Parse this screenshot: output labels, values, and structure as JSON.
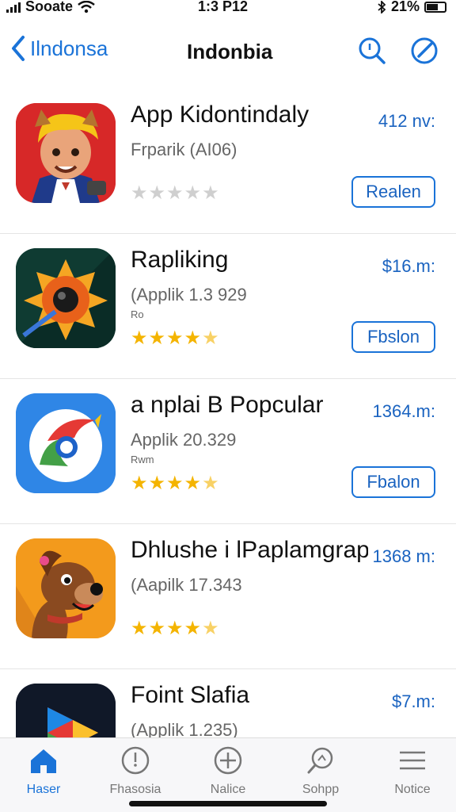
{
  "status": {
    "carrier": "Sooate",
    "time": "1:3 P12",
    "battery": "21%"
  },
  "nav": {
    "back_label": "Ilndonsa",
    "title": "Indonbia"
  },
  "apps": [
    {
      "name": "App Kidontindaly",
      "subtitle": "Frparik (AI06)",
      "extra": "",
      "price": "412 nv:",
      "button": "Realen",
      "rating": 0,
      "icon": "kid-character-icon"
    },
    {
      "name": "Rapliking",
      "subtitle": "(Applik 1.3 929",
      "extra": "Ro",
      "price": "$16.m:",
      "button": "Fbslon",
      "rating": 4.5,
      "icon": "sun-camera-icon"
    },
    {
      "name": "a nplai B Popcular",
      "subtitle": "Applik 20.329",
      "extra": "Rwm",
      "price": "1364.m:",
      "button": "Fbalon",
      "rating": 4.5,
      "icon": "chrome-swirl-icon"
    },
    {
      "name": "Dhlushe i lPaplamgrapm",
      "subtitle": "(Aapilk 17.343",
      "extra": "",
      "price": "1368 m:",
      "button": "",
      "rating": 4.5,
      "icon": "dog-character-icon"
    },
    {
      "name": "Foint Slafia",
      "subtitle": "(Applik 1.235)",
      "extra": "",
      "price": "$7.m:",
      "button": "",
      "rating": 0,
      "icon": "play-triangle-icon"
    }
  ],
  "tabs": [
    {
      "label": "Haser",
      "icon": "home-icon",
      "active": true
    },
    {
      "label": "Fhasosia",
      "icon": "clock-icon",
      "active": false
    },
    {
      "label": "Nalice",
      "icon": "plus-circle-icon",
      "active": false
    },
    {
      "label": "Sohpp",
      "icon": "search-icon",
      "active": false
    },
    {
      "label": "Notice",
      "icon": "menu-icon",
      "active": false
    }
  ],
  "colors": {
    "accent": "#1a73d8",
    "star": "#f4b400",
    "price": "#1a63c0"
  }
}
